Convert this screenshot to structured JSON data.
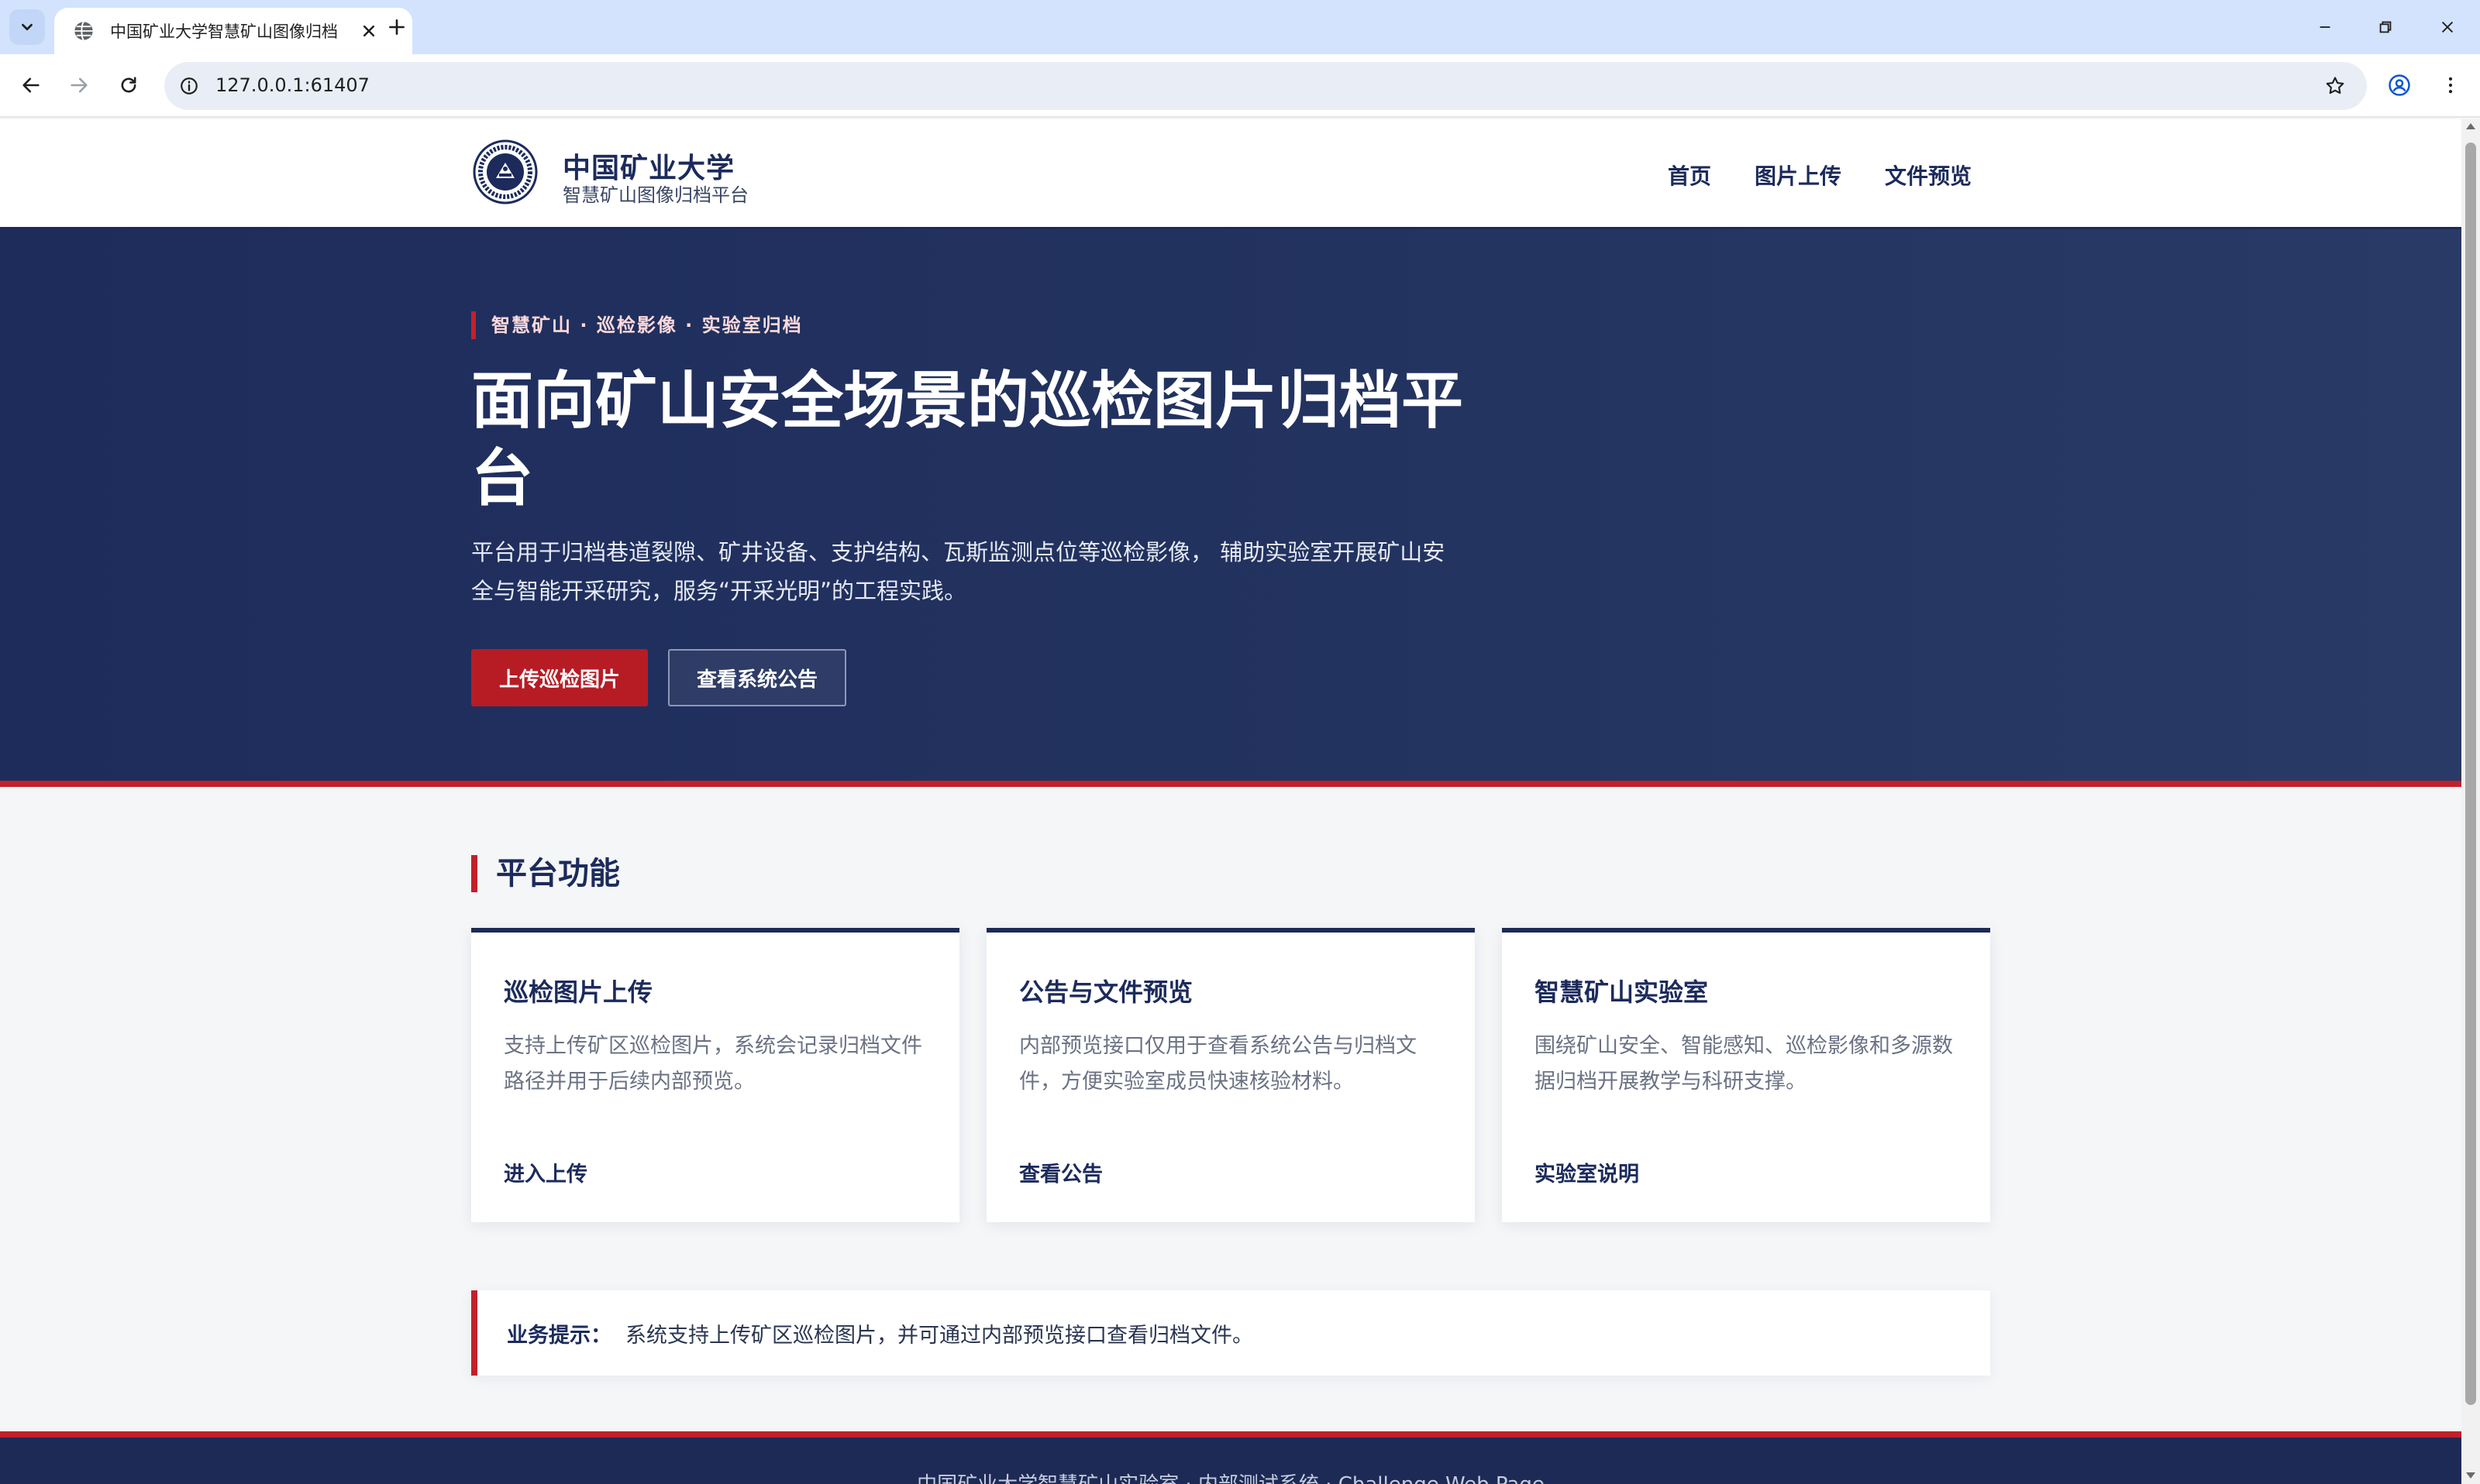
{
  "browser": {
    "tab_title": "中国矿业大学智慧矿山图像归档",
    "url": "127.0.0.1:61407"
  },
  "site": {
    "brand_name": "中国矿业大学",
    "brand_sub": "智慧矿山图像归档平台",
    "nav": [
      "首页",
      "图片上传",
      "文件预览"
    ]
  },
  "hero": {
    "kicker": "智慧矿山 · 巡检影像 · 实验室归档",
    "title": "面向矿山安全场景的巡检图片归档平台",
    "description": "平台用于归档巷道裂隙、矿井设备、支护结构、瓦斯监测点位等巡检影像， 辅助实验室开展矿山安全与智能开采研究，服务“开采光明”的工程实践。",
    "primary_button": "上传巡检图片",
    "secondary_button": "查看系统公告"
  },
  "features": {
    "title": "平台功能",
    "cards": [
      {
        "title": "巡检图片上传",
        "description": "支持上传矿区巡检图片，系统会记录归档文件路径并用于后续内部预览。",
        "link": "进入上传"
      },
      {
        "title": "公告与文件预览",
        "description": "内部预览接口仅用于查看系统公告与归档文件，方便实验室成员快速核验材料。",
        "link": "查看公告"
      },
      {
        "title": "智慧矿山实验室",
        "description": "围绕矿山安全、智能感知、巡检影像和多源数据归档开展教学与科研支撑。",
        "link": "实验室说明"
      }
    ]
  },
  "notice": {
    "label": "业务提示：",
    "text": "系统支持上传矿区巡检图片，并可通过内部预览接口查看归档文件。"
  },
  "footer": {
    "text": "中国矿业大学智慧矿山实验室 · 内部测试系统 · Challenge Web Page"
  },
  "colors": {
    "navy": "#1d2a55",
    "accent_red": "#c3202b",
    "tab_strip": "#d3e3fd"
  }
}
